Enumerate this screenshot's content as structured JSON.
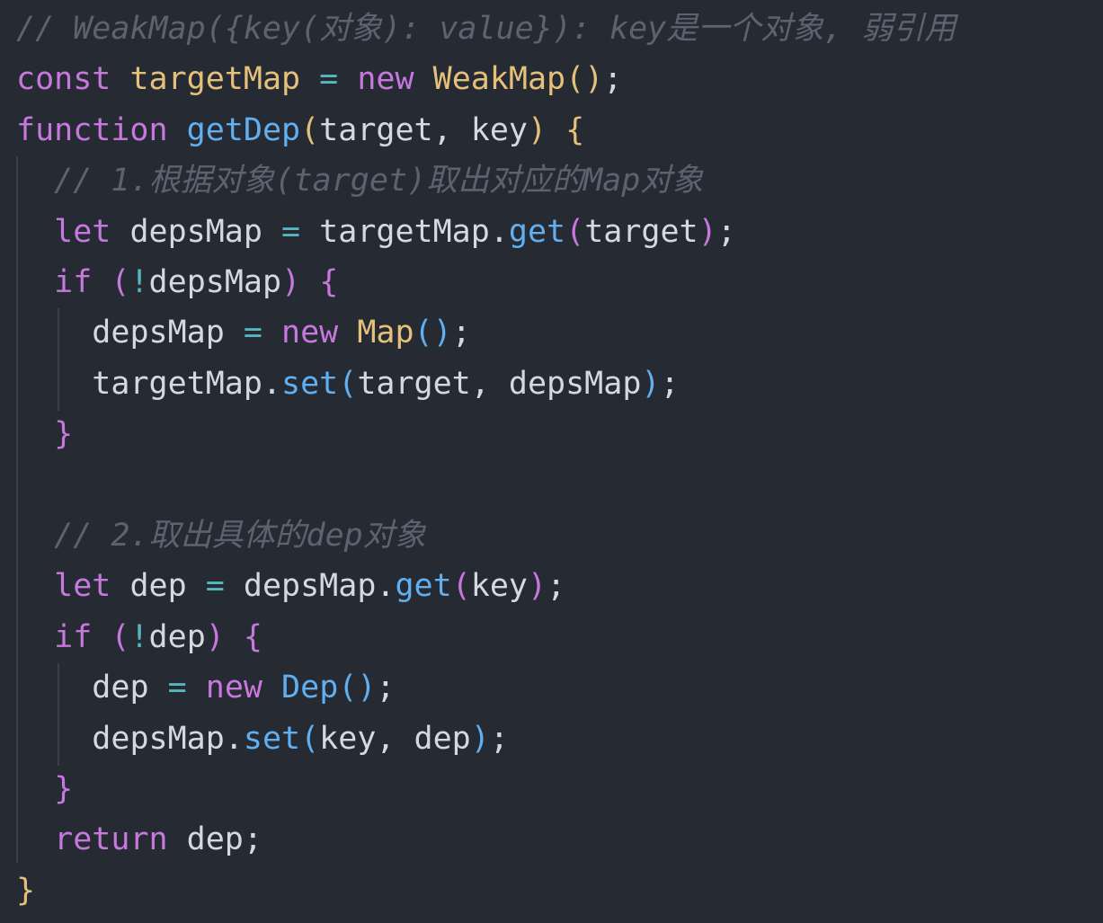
{
  "colors": {
    "background": "#262a33",
    "comment": "#5c6370",
    "keyword": "#c678dd",
    "function": "#61afef",
    "class": "#e5c07b",
    "operator": "#56b6c2",
    "plain": "#d4d8df"
  },
  "lines": [
    {
      "tokens": [
        {
          "t": "// WeakMap({key(对象): value}): key是一个对象, 弱引用",
          "c": "comment"
        }
      ]
    },
    {
      "tokens": [
        {
          "t": "const",
          "c": "storage"
        },
        {
          "t": " ",
          "c": "plain"
        },
        {
          "t": "targetMap",
          "c": "variable"
        },
        {
          "t": " ",
          "c": "plain"
        },
        {
          "t": "=",
          "c": "operator"
        },
        {
          "t": " ",
          "c": "plain"
        },
        {
          "t": "new",
          "c": "keyword"
        },
        {
          "t": " ",
          "c": "plain"
        },
        {
          "t": "WeakMap",
          "c": "class"
        },
        {
          "t": "()",
          "c": "paren"
        },
        {
          "t": ";",
          "c": "punct"
        }
      ]
    },
    {
      "tokens": [
        {
          "t": "function",
          "c": "storage"
        },
        {
          "t": " ",
          "c": "plain"
        },
        {
          "t": "getDep",
          "c": "function"
        },
        {
          "t": "(",
          "c": "paren"
        },
        {
          "t": "target, key",
          "c": "plain"
        },
        {
          "t": ")",
          "c": "paren"
        },
        {
          "t": " ",
          "c": "plain"
        },
        {
          "t": "{",
          "c": "paren"
        }
      ]
    },
    {
      "tokens": [
        {
          "t": "  ",
          "c": "plain"
        },
        {
          "t": "// 1.根据对象(target)取出对应的Map对象",
          "c": "comment"
        }
      ]
    },
    {
      "tokens": [
        {
          "t": "  ",
          "c": "plain"
        },
        {
          "t": "let",
          "c": "storage"
        },
        {
          "t": " depsMap ",
          "c": "plain"
        },
        {
          "t": "=",
          "c": "operator"
        },
        {
          "t": " targetMap.",
          "c": "plain"
        },
        {
          "t": "get",
          "c": "function"
        },
        {
          "t": "(",
          "c": "paren2"
        },
        {
          "t": "target",
          "c": "plain"
        },
        {
          "t": ")",
          "c": "paren2"
        },
        {
          "t": ";",
          "c": "punct"
        }
      ]
    },
    {
      "tokens": [
        {
          "t": "  ",
          "c": "plain"
        },
        {
          "t": "if",
          "c": "keyword"
        },
        {
          "t": " ",
          "c": "plain"
        },
        {
          "t": "(",
          "c": "paren2"
        },
        {
          "t": "!",
          "c": "operator"
        },
        {
          "t": "depsMap",
          "c": "plain"
        },
        {
          "t": ")",
          "c": "paren2"
        },
        {
          "t": " ",
          "c": "plain"
        },
        {
          "t": "{",
          "c": "paren2"
        }
      ]
    },
    {
      "tokens": [
        {
          "t": "    ",
          "c": "plain"
        },
        {
          "t": "depsMap ",
          "c": "plain"
        },
        {
          "t": "=",
          "c": "operator"
        },
        {
          "t": " ",
          "c": "plain"
        },
        {
          "t": "new",
          "c": "keyword"
        },
        {
          "t": " ",
          "c": "plain"
        },
        {
          "t": "Map",
          "c": "class"
        },
        {
          "t": "()",
          "c": "paren3"
        },
        {
          "t": ";",
          "c": "punct"
        }
      ]
    },
    {
      "tokens": [
        {
          "t": "    ",
          "c": "plain"
        },
        {
          "t": "targetMap.",
          "c": "plain"
        },
        {
          "t": "set",
          "c": "function"
        },
        {
          "t": "(",
          "c": "paren3"
        },
        {
          "t": "target, depsMap",
          "c": "plain"
        },
        {
          "t": ")",
          "c": "paren3"
        },
        {
          "t": ";",
          "c": "punct"
        }
      ]
    },
    {
      "tokens": [
        {
          "t": "  ",
          "c": "plain"
        },
        {
          "t": "}",
          "c": "paren2"
        }
      ]
    },
    {
      "tokens": [
        {
          "t": "",
          "c": "plain"
        }
      ]
    },
    {
      "tokens": [
        {
          "t": "  ",
          "c": "plain"
        },
        {
          "t": "// 2.取出具体的dep对象",
          "c": "comment"
        }
      ]
    },
    {
      "tokens": [
        {
          "t": "  ",
          "c": "plain"
        },
        {
          "t": "let",
          "c": "storage"
        },
        {
          "t": " dep ",
          "c": "plain"
        },
        {
          "t": "=",
          "c": "operator"
        },
        {
          "t": " depsMap.",
          "c": "plain"
        },
        {
          "t": "get",
          "c": "function"
        },
        {
          "t": "(",
          "c": "paren2"
        },
        {
          "t": "key",
          "c": "plain"
        },
        {
          "t": ")",
          "c": "paren2"
        },
        {
          "t": ";",
          "c": "punct"
        }
      ]
    },
    {
      "tokens": [
        {
          "t": "  ",
          "c": "plain"
        },
        {
          "t": "if",
          "c": "keyword"
        },
        {
          "t": " ",
          "c": "plain"
        },
        {
          "t": "(",
          "c": "paren2"
        },
        {
          "t": "!",
          "c": "operator"
        },
        {
          "t": "dep",
          "c": "plain"
        },
        {
          "t": ")",
          "c": "paren2"
        },
        {
          "t": " ",
          "c": "plain"
        },
        {
          "t": "{",
          "c": "paren2"
        }
      ]
    },
    {
      "tokens": [
        {
          "t": "    ",
          "c": "plain"
        },
        {
          "t": "dep ",
          "c": "plain"
        },
        {
          "t": "=",
          "c": "operator"
        },
        {
          "t": " ",
          "c": "plain"
        },
        {
          "t": "new",
          "c": "keyword"
        },
        {
          "t": " ",
          "c": "plain"
        },
        {
          "t": "Dep",
          "c": "function"
        },
        {
          "t": "()",
          "c": "paren3"
        },
        {
          "t": ";",
          "c": "punct"
        }
      ]
    },
    {
      "tokens": [
        {
          "t": "    ",
          "c": "plain"
        },
        {
          "t": "depsMap.",
          "c": "plain"
        },
        {
          "t": "set",
          "c": "function"
        },
        {
          "t": "(",
          "c": "paren3"
        },
        {
          "t": "key, dep",
          "c": "plain"
        },
        {
          "t": ")",
          "c": "paren3"
        },
        {
          "t": ";",
          "c": "punct"
        }
      ]
    },
    {
      "tokens": [
        {
          "t": "  ",
          "c": "plain"
        },
        {
          "t": "}",
          "c": "paren2"
        }
      ]
    },
    {
      "tokens": [
        {
          "t": "  ",
          "c": "plain"
        },
        {
          "t": "return",
          "c": "keyword"
        },
        {
          "t": " dep;",
          "c": "plain"
        }
      ]
    },
    {
      "tokens": [
        {
          "t": "}",
          "c": "paren"
        }
      ]
    }
  ]
}
